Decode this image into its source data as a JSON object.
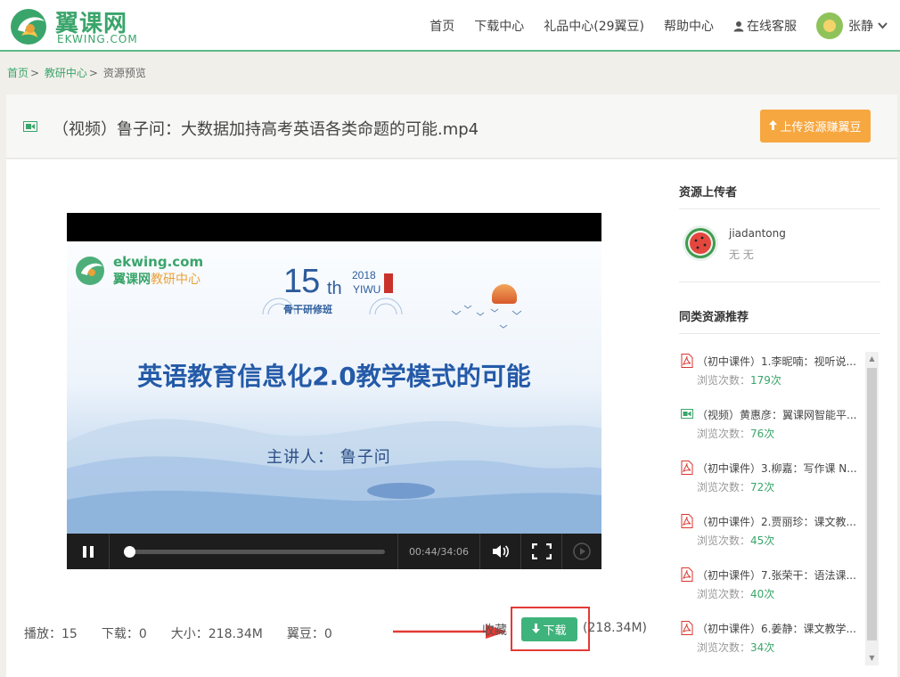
{
  "header": {
    "logo_cn": "翼课网",
    "logo_en": "EKWING.COM",
    "nav": [
      {
        "label": "首页"
      },
      {
        "label": "下载中心"
      },
      {
        "label": "礼品中心(29翼豆)"
      },
      {
        "label": "帮助中心"
      },
      {
        "label": "在线客服",
        "icon": "person-icon"
      }
    ],
    "user_name": "张静"
  },
  "breadcrumb": {
    "home": "首页",
    "section": "教研中心",
    "current": "资源预览",
    "separator": ">"
  },
  "title_bar": {
    "title": "（视频）鲁子问：大数据加持高考英语各类命题的可能.mp4",
    "upload_label": "上传资源赚翼豆"
  },
  "player": {
    "watermark_en": "ekwing.com",
    "watermark_cn": "翼课网",
    "watermark_cn_2": "教研中心",
    "badge_number": "15",
    "badge_suffix": "th",
    "badge_year": "2018",
    "badge_city": "YIWU",
    "badge_subtitle": "骨干研修班",
    "slide_heading": "英语教育信息化2.0教学模式的可能",
    "slide_presenter": "主讲人：  鲁子问",
    "current_time": "00:44",
    "duration": "34:06",
    "time_display": "00:44/34:06",
    "progress_fraction": 0.0215
  },
  "stats": {
    "plays": "播放：15",
    "downloads": "下载：0",
    "size": "大小：218.34M",
    "beans": "翼豆：0"
  },
  "actions": {
    "collect_label": "收藏",
    "download_label": "下载",
    "size_note": "(218.34M)"
  },
  "sidebar": {
    "uploader_heading": "资源上传者",
    "uploader_name": "jiadantong",
    "uploader_sub": "无 无",
    "rec_heading": "同类资源推荐",
    "views_prefix": "浏览次数：",
    "views_suffix": "次",
    "items": [
      {
        "title": "（初中课件）1.李昵喃：视听说...",
        "views": "179",
        "type": "pdf"
      },
      {
        "title": "（视频）黄惠彦：翼课网智能平...",
        "views": "76",
        "type": "video"
      },
      {
        "title": "（初中课件）3.柳嘉：写作课 N...",
        "views": "72",
        "type": "pdf"
      },
      {
        "title": "（初中课件）2.贾丽珍：课文教...",
        "views": "45",
        "type": "pdf"
      },
      {
        "title": "（初中课件）7.张荣干：语法课...",
        "views": "40",
        "type": "pdf"
      },
      {
        "title": "（初中课件）6.姜静：课文教学...",
        "views": "34",
        "type": "pdf"
      }
    ]
  },
  "colors": {
    "brand_green": "#3aa56b",
    "upload_orange": "#f7a740",
    "download_green": "#3fb37c",
    "highlight_red": "#e33b36",
    "pdf_red": "#d9362f"
  }
}
